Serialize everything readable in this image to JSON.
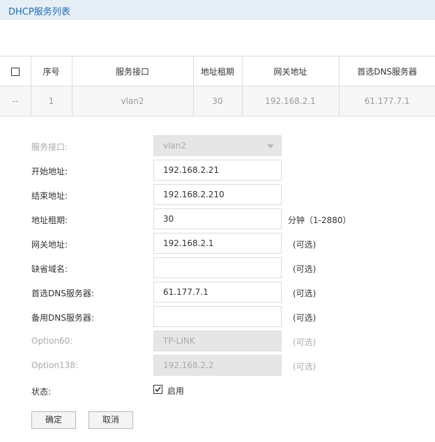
{
  "header": {
    "title": "DHCP服务列表"
  },
  "table": {
    "columns": [
      "序号",
      "服务接口",
      "地址租期",
      "网关地址",
      "首选DNS服务器"
    ],
    "rows": [
      {
        "select": "--",
        "index": "1",
        "interface": "vlan2",
        "lease": "30",
        "gateway": "192.168.2.1",
        "dns": "61.177.7.1"
      }
    ]
  },
  "form": {
    "interface": {
      "label": "服务接口:",
      "value": "vlan2"
    },
    "start": {
      "label": "开始地址:",
      "value": "192.168.2.21"
    },
    "end": {
      "label": "结束地址:",
      "value": "192.168.2.210"
    },
    "lease": {
      "label": "地址租期:",
      "value": "30",
      "suffix": "分钟（1-2880）"
    },
    "gateway": {
      "label": "网关地址:",
      "value": "192.168.2.1",
      "suffix": "(可选)"
    },
    "domain": {
      "label": "缺省域名:",
      "value": "",
      "suffix": "(可选)"
    },
    "dns1": {
      "label": "首选DNS服务器:",
      "value": "61.177.7.1",
      "suffix": "(可选)"
    },
    "dns2": {
      "label": "备用DNS服务器:",
      "value": "",
      "suffix": "(可选)"
    },
    "opt60": {
      "label": "Option60:",
      "value": "TP-LINK",
      "suffix": "(可选)"
    },
    "opt138": {
      "label": "Option138:",
      "value": "192.168.2.2",
      "suffix": "(可选)"
    },
    "status": {
      "label": "状态:",
      "checkbox_label": "启用",
      "checked": true
    }
  },
  "buttons": {
    "ok": "确定",
    "cancel": "取消"
  },
  "icons": {
    "dropdown": "chevron-down-icon",
    "check": "check-icon"
  }
}
